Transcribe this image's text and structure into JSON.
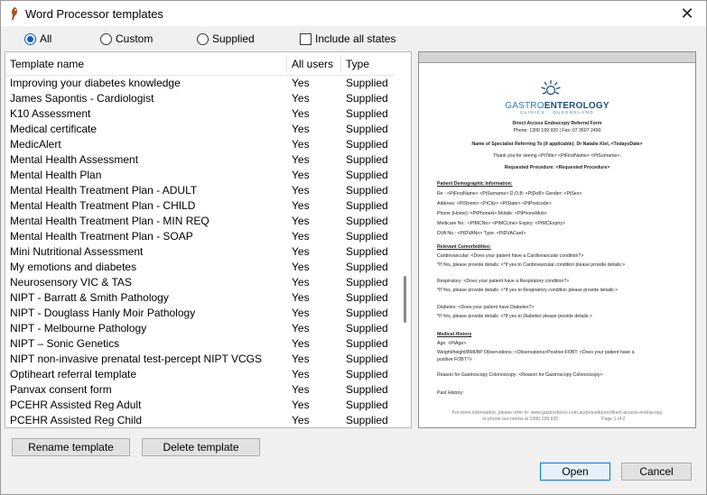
{
  "window": {
    "title": "Word Processor templates"
  },
  "filters": {
    "radios": [
      {
        "label": "All",
        "checked": true
      },
      {
        "label": "Custom",
        "checked": false
      },
      {
        "label": "Supplied",
        "checked": false
      }
    ],
    "include_all_states": {
      "label": "Include all states",
      "checked": false
    }
  },
  "list": {
    "columns": [
      "Template name",
      "All users",
      "Type"
    ],
    "rows": [
      [
        "Improving your diabetes knowledge",
        "Yes",
        "Supplied"
      ],
      [
        "James Sapontis - Cardiologist",
        "Yes",
        "Supplied"
      ],
      [
        "K10 Assessment",
        "Yes",
        "Supplied"
      ],
      [
        "Medical certificate",
        "Yes",
        "Supplied"
      ],
      [
        "MedicAlert",
        "Yes",
        "Supplied"
      ],
      [
        "Mental Health Assessment",
        "Yes",
        "Supplied"
      ],
      [
        "Mental Health Plan",
        "Yes",
        "Supplied"
      ],
      [
        "Mental Health Treatment Plan - ADULT",
        "Yes",
        "Supplied"
      ],
      [
        "Mental Health Treatment Plan - CHILD",
        "Yes",
        "Supplied"
      ],
      [
        "Mental Health Treatment Plan - MIN REQ",
        "Yes",
        "Supplied"
      ],
      [
        "Mental Health Treatment Plan - SOAP",
        "Yes",
        "Supplied"
      ],
      [
        "Mini Nutritional Assessment",
        "Yes",
        "Supplied"
      ],
      [
        "My emotions and diabetes",
        "Yes",
        "Supplied"
      ],
      [
        "Neurosensory VIC & TAS",
        "Yes",
        "Supplied"
      ],
      [
        "NIPT - Barratt & Smith Pathology",
        "Yes",
        "Supplied"
      ],
      [
        "NIPT - Douglass Hanly Moir Pathology",
        "Yes",
        "Supplied"
      ],
      [
        "NIPT - Melbourne Pathology",
        "Yes",
        "Supplied"
      ],
      [
        "NIPT – Sonic Genetics",
        "Yes",
        "Supplied"
      ],
      [
        "NIPT non-invasive prenatal test-percept NIPT VCGS",
        "Yes",
        "Supplied"
      ],
      [
        "Optiheart referral template",
        "Yes",
        "Supplied"
      ],
      [
        "Panvax consent form",
        "Yes",
        "Supplied"
      ],
      [
        "PCEHR Assisted Reg Adult",
        "Yes",
        "Supplied"
      ],
      [
        "PCEHR Assisted Reg Child",
        "Yes",
        "Supplied"
      ]
    ]
  },
  "preview": {
    "logo_main_a": "GASTRO",
    "logo_main_b": "ENTEROLOGY",
    "logo_sub": "CLINICS · QUEENSLAND",
    "heading": "Direct Access Endoscopy Referral Form",
    "phone_line": "Phone: 1300 199 920 | Fax: 07 3607 2490",
    "specialist_line": "Name of Specialist Referring To (if applicable): Dr Natalie Kiel,  <TodaysDate>",
    "thanks_line": "Thank you for seeing  <PtTitle>  <PtFirstName>  <PtSurname>.",
    "requested_line": "Requested Procedure: <Requested Procedure>",
    "demo_heading": "Patient Demographic Information:",
    "demo_lines": [
      "Re : <PtFirstName> <PtSurname>  D.O.B: <PtDoB>   Gender: <PtSex>",
      "Address: <PtStreet> <PtCity> <PtState> <PtPostcode>",
      "Phone (Home): <PtPhoneH>    Mobile: <PtPhoneMob>",
      "Medicare No.: <PtMCNo> <PtMCLine>  Expiry: <PtMCExpiry>",
      "DVA No.: <PtDVANo> Type: <PtDVACard>"
    ],
    "comorb_heading": "Relevant Comorbidities:",
    "comorb_lines": [
      "Cardiovascular: <Does your patient have a Cardiovascular condition?>",
      "*If Yes, please provide details: <*If yes to Cardiovascular condition please provide details:>",
      "Respiratory: <Does your patient have a Respiratory condition?>",
      "*If Yes, please provide details: <*If yes to Respiratory condition please provide details:>",
      "Diabetes: <Does your patient have Diabetes?>",
      "*If Yes, please provide details: <*If yes to Diabetes please provide details:>"
    ],
    "history_heading": "Medical History",
    "history_lines": [
      "Age: <PtAge>",
      "Weight/height/BMI/BP Observations: <Observations>Positive FOBT: <Does your patient have  a",
      "positive FOBT?>",
      "Reason for Gastroscopy Colonoscopy: <Reason for Gastroscopy Colonoscopy>",
      "Past History:"
    ],
    "footer_1": "For more information, please refer to: www.gastroclinics.com.au/procedures/direct-access-endoscopy",
    "footer_2": "or phone our rooms at 1300 199 920",
    "footer_page": "Page 1 of 2"
  },
  "buttons": {
    "rename": "Rename template",
    "delete": "Delete template",
    "open": "Open",
    "cancel": "Cancel"
  }
}
